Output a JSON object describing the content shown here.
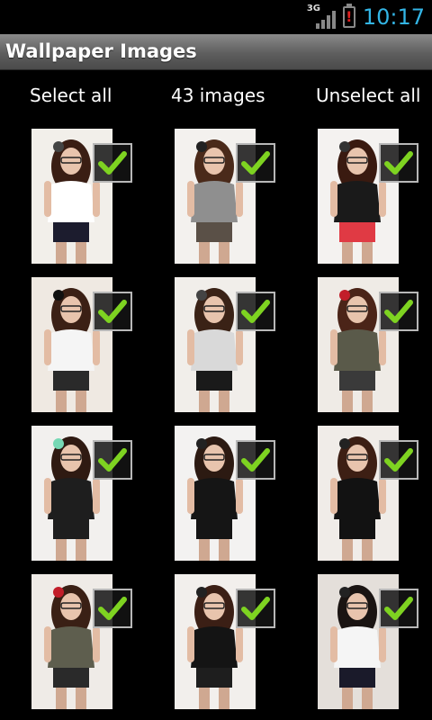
{
  "status_bar": {
    "network_type": "3G",
    "battery_icon": "battery-alert-icon",
    "time": "10:17",
    "accent_color": "#33b5e5"
  },
  "title_bar": {
    "title": "Wallpaper Images"
  },
  "actions": {
    "select_all": "Select all",
    "count_label": "43 images",
    "unselect_all": "Unselect all"
  },
  "images": [
    {
      "checked": true,
      "top": "#ffffff",
      "bottom": "#1c1c2e",
      "bg": "#f2efea",
      "hair": "#3a1e14",
      "accent": "#444"
    },
    {
      "checked": true,
      "top": "#8f8f8f",
      "bottom": "#5a5047",
      "bg": "#f3f1ee",
      "hair": "#4a2a1a",
      "accent": "#222"
    },
    {
      "checked": true,
      "top": "#1a1a1a",
      "bottom": "#e03a44",
      "bg": "#f4f2f0",
      "hair": "#3a1a10",
      "accent": "#333"
    },
    {
      "checked": true,
      "top": "#f5f5f5",
      "bottom": "#2a2a2a",
      "bg": "#efe9e2",
      "hair": "#3b2015",
      "accent": "#111"
    },
    {
      "checked": true,
      "top": "#d9d9d9",
      "bottom": "#1a1a1a",
      "bg": "#f1eeea",
      "hair": "#3a2216",
      "accent": "#444"
    },
    {
      "checked": true,
      "top": "#5a5a4a",
      "bottom": "#3a3a3a",
      "bg": "#efebe6",
      "hair": "#4b2418",
      "accent": "#c21e2a"
    },
    {
      "checked": true,
      "top": "#1e1e1e",
      "bottom": "#1e1e1e",
      "bg": "#f2f0ee",
      "hair": "#2f1a12",
      "accent": "#76d8b4"
    },
    {
      "checked": true,
      "top": "#151515",
      "bottom": "#151515",
      "bg": "#f3f2f1",
      "hair": "#2c1a12",
      "accent": "#222"
    },
    {
      "checked": true,
      "top": "#121212",
      "bottom": "#121212",
      "bg": "#f0ece8",
      "hair": "#3d1f14",
      "accent": "#222"
    },
    {
      "checked": true,
      "top": "#5e5e4e",
      "bottom": "#2a2a2a",
      "bg": "#efebe7",
      "hair": "#3a2015",
      "accent": "#c21e2a"
    },
    {
      "checked": true,
      "top": "#141414",
      "bottom": "#1e1e1e",
      "bg": "#f2efec",
      "hair": "#3b1f15",
      "accent": "#222"
    },
    {
      "checked": true,
      "top": "#f5f5f5",
      "bottom": "#1a1a2a",
      "bg": "#e4dfda",
      "hair": "#1a1412",
      "accent": "#222"
    }
  ]
}
